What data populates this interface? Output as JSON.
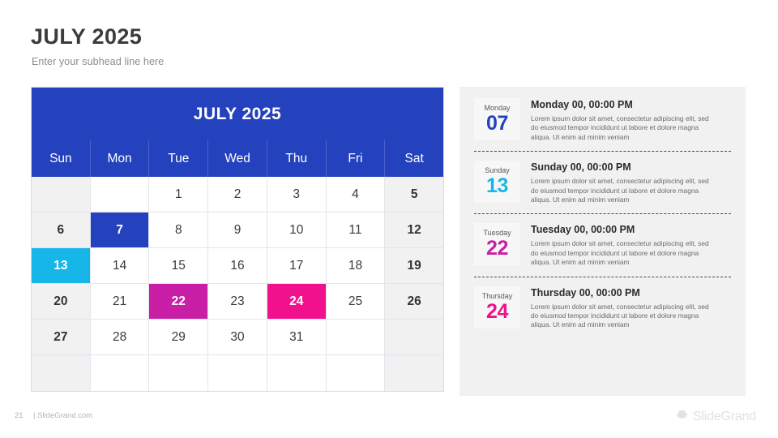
{
  "header": {
    "title": "JULY 2025",
    "subhead": "Enter your subhead line here"
  },
  "calendar": {
    "title": "JULY 2025",
    "day_headers": [
      "Sun",
      "Mon",
      "Tue",
      "Wed",
      "Thu",
      "Fri",
      "Sat"
    ],
    "weeks": [
      [
        {
          "label": "",
          "style": "weekend"
        },
        {
          "label": "",
          "style": "normal"
        },
        {
          "label": "1",
          "style": "normal"
        },
        {
          "label": "2",
          "style": "normal"
        },
        {
          "label": "3",
          "style": "normal"
        },
        {
          "label": "4",
          "style": "normal"
        },
        {
          "label": "5",
          "style": "weekend"
        }
      ],
      [
        {
          "label": "6",
          "style": "weekend"
        },
        {
          "label": "7",
          "style": "hl-blue"
        },
        {
          "label": "8",
          "style": "normal"
        },
        {
          "label": "9",
          "style": "normal"
        },
        {
          "label": "10",
          "style": "normal"
        },
        {
          "label": "11",
          "style": "normal"
        },
        {
          "label": "12",
          "style": "weekend"
        }
      ],
      [
        {
          "label": "13",
          "style": "hl-cyan"
        },
        {
          "label": "14",
          "style": "normal"
        },
        {
          "label": "15",
          "style": "normal"
        },
        {
          "label": "16",
          "style": "normal"
        },
        {
          "label": "17",
          "style": "normal"
        },
        {
          "label": "18",
          "style": "normal"
        },
        {
          "label": "19",
          "style": "weekend"
        }
      ],
      [
        {
          "label": "20",
          "style": "weekend"
        },
        {
          "label": "21",
          "style": "normal"
        },
        {
          "label": "22",
          "style": "hl-purple"
        },
        {
          "label": "23",
          "style": "normal"
        },
        {
          "label": "24",
          "style": "hl-pink"
        },
        {
          "label": "25",
          "style": "normal"
        },
        {
          "label": "26",
          "style": "weekend"
        }
      ],
      [
        {
          "label": "27",
          "style": "weekend"
        },
        {
          "label": "28",
          "style": "normal"
        },
        {
          "label": "29",
          "style": "normal"
        },
        {
          "label": "30",
          "style": "normal"
        },
        {
          "label": "31",
          "style": "normal"
        },
        {
          "label": "",
          "style": "normal"
        },
        {
          "label": "",
          "style": "weekend"
        }
      ],
      [
        {
          "label": "",
          "style": "weekend"
        },
        {
          "label": "",
          "style": "normal"
        },
        {
          "label": "",
          "style": "normal"
        },
        {
          "label": "",
          "style": "normal"
        },
        {
          "label": "",
          "style": "normal"
        },
        {
          "label": "",
          "style": "normal"
        },
        {
          "label": "",
          "style": "weekend"
        }
      ]
    ]
  },
  "events": [
    {
      "badge_dow": "Monday",
      "badge_num": "07",
      "color_class": "c-blue",
      "title": "Monday 00, 00:00 PM",
      "description": "Lorem ipsum dolor sit amet, consectetur adipiscing elit, sed do eiusmod tempor incididunt ut labore et dolore magna aliqua. Ut enim ad minim veniam"
    },
    {
      "badge_dow": "Sunday",
      "badge_num": "13",
      "color_class": "c-cyan",
      "title": "Sunday 00, 00:00 PM",
      "description": "Lorem ipsum dolor sit amet, consectetur adipiscing elit, sed do eiusmod tempor incididunt ut labore et dolore magna aliqua. Ut enim ad minim veniam"
    },
    {
      "badge_dow": "Tuesday",
      "badge_num": "22",
      "color_class": "c-purple",
      "title": "Tuesday 00, 00:00 PM",
      "description": "Lorem ipsum dolor sit amet, consectetur adipiscing elit, sed do eiusmod tempor incididunt ut labore et dolore magna aliqua. Ut enim ad minim veniam"
    },
    {
      "badge_dow": "Thursday",
      "badge_num": "24",
      "color_class": "c-pink",
      "title": "Thursday 00, 00:00 PM",
      "description": "Lorem ipsum dolor sit amet, consectetur adipiscing elit, sed do eiusmod tempor incididunt ut labore et dolore magna aliqua. Ut enim ad minim veniam"
    }
  ],
  "footer": {
    "page_number": "21",
    "site": "| SlideGrand.com",
    "brand_name": "SlideGrand",
    "brand_icon": "cup-logo-icon"
  },
  "colors": {
    "primary_blue": "#2442bd",
    "cyan": "#16b6e8",
    "purple": "#c81fa6",
    "pink": "#f2118c",
    "panel_gray": "#f1f1f1"
  }
}
